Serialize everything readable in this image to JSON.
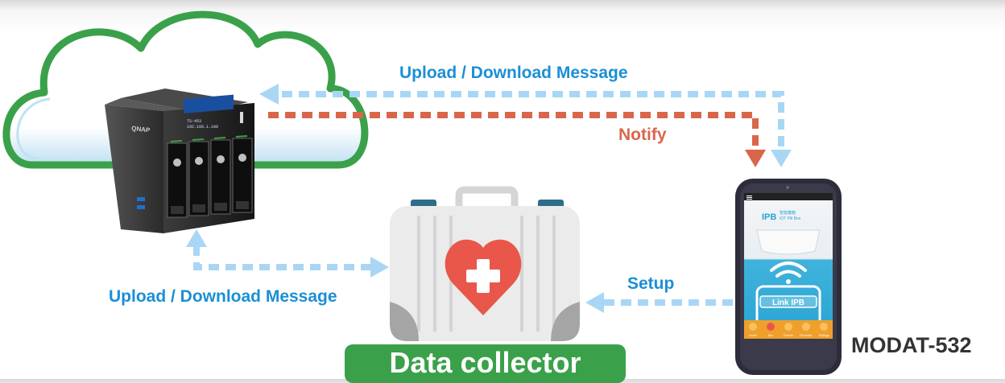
{
  "labels": {
    "upload_top": "Upload / Download Message",
    "notify": "Notify",
    "setup": "Setup",
    "upload_left": "Upload / Download Message",
    "model": "MODAT-532",
    "collector": "Data collector"
  },
  "nas": {
    "brand": "QNAP",
    "lcd_line1": "TS-453",
    "lcd_line2": "192.168.1.100"
  },
  "phone": {
    "app_logo": "IPB",
    "app_subtitle": "智能藥箱",
    "app_subtitle2": "IOT Pill Box",
    "link_button": "Link IPB",
    "tabs": [
      "Home",
      "Box",
      "Friends",
      "Reminder",
      "Settings"
    ]
  },
  "colors": {
    "upload_arrow": "#a9d6f5",
    "notify_arrow": "#d9664a",
    "cloud_outline": "#3aa14a",
    "badge": "#3aa14a",
    "heart": "#e8574a"
  }
}
